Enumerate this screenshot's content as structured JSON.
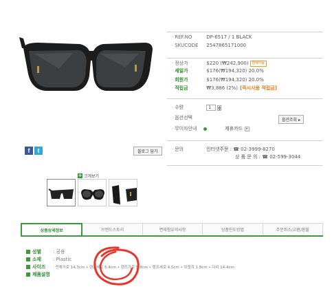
{
  "product": {
    "ref_label": "REF.NO",
    "ref_value": "DP-6517 / 1 BLACK",
    "sku_label": "SKUCODE",
    "sku_value": "2547865171000",
    "list_price_label": "정상가",
    "list_price_value": "$220 (₩242,900)",
    "list_price_tag": "판매가능",
    "sale_price_label": "세일가",
    "sale_price_value": "$176(₩194,320) 20.0%",
    "member_price_label": "회원가",
    "member_price_value": "$176(₩194,320) 20.0%",
    "points_label": "적립금",
    "points_value": "₩3,886 (2%)",
    "points_tag": "[즉시사용 적립금]",
    "qty_label": "수량",
    "qty_value": "1",
    "option_label": "옵션선택",
    "option_button": "옵션조회 ▸",
    "nointerest_label": "무이자안내",
    "nointerest_value": "제휴카드",
    "inquiry_label": "문의",
    "inquiry_online": "인터넷주문 : ☎ 02-3999-8270",
    "inquiry_phone": "상 품 문 의 : ☎ 02-599-3044"
  },
  "gallery": {
    "blog_button": "블로그 담기",
    "zoom_label": "크게보기",
    "share": [
      "f",
      "t"
    ]
  },
  "tabs": [
    {
      "label": "상품상세정보",
      "active": true
    },
    {
      "label": "브랜드스토리",
      "active": false
    },
    {
      "label": "면세점유의사항",
      "active": false
    },
    {
      "label": "상품인도방법",
      "active": false
    },
    {
      "label": "주문취소/교환/환불",
      "active": false
    }
  ],
  "details": [
    {
      "key": "성별",
      "value": ": 공용"
    },
    {
      "key": "소재",
      "value": ": Plastic"
    },
    {
      "key": "사이즈",
      "value": ": 전체가로 14.3cm • 렌즈세로 5.4cm • 렌즈가로 5.8cm • 렌즈세로 4.5cm • 브릿지 1.8cm • 다리 14.4cm"
    },
    {
      "key": "제품설명",
      "value": ""
    }
  ],
  "colors": {
    "accent": "#3a9a3a",
    "price": "#e07a10",
    "annotation": "#e8352a"
  }
}
